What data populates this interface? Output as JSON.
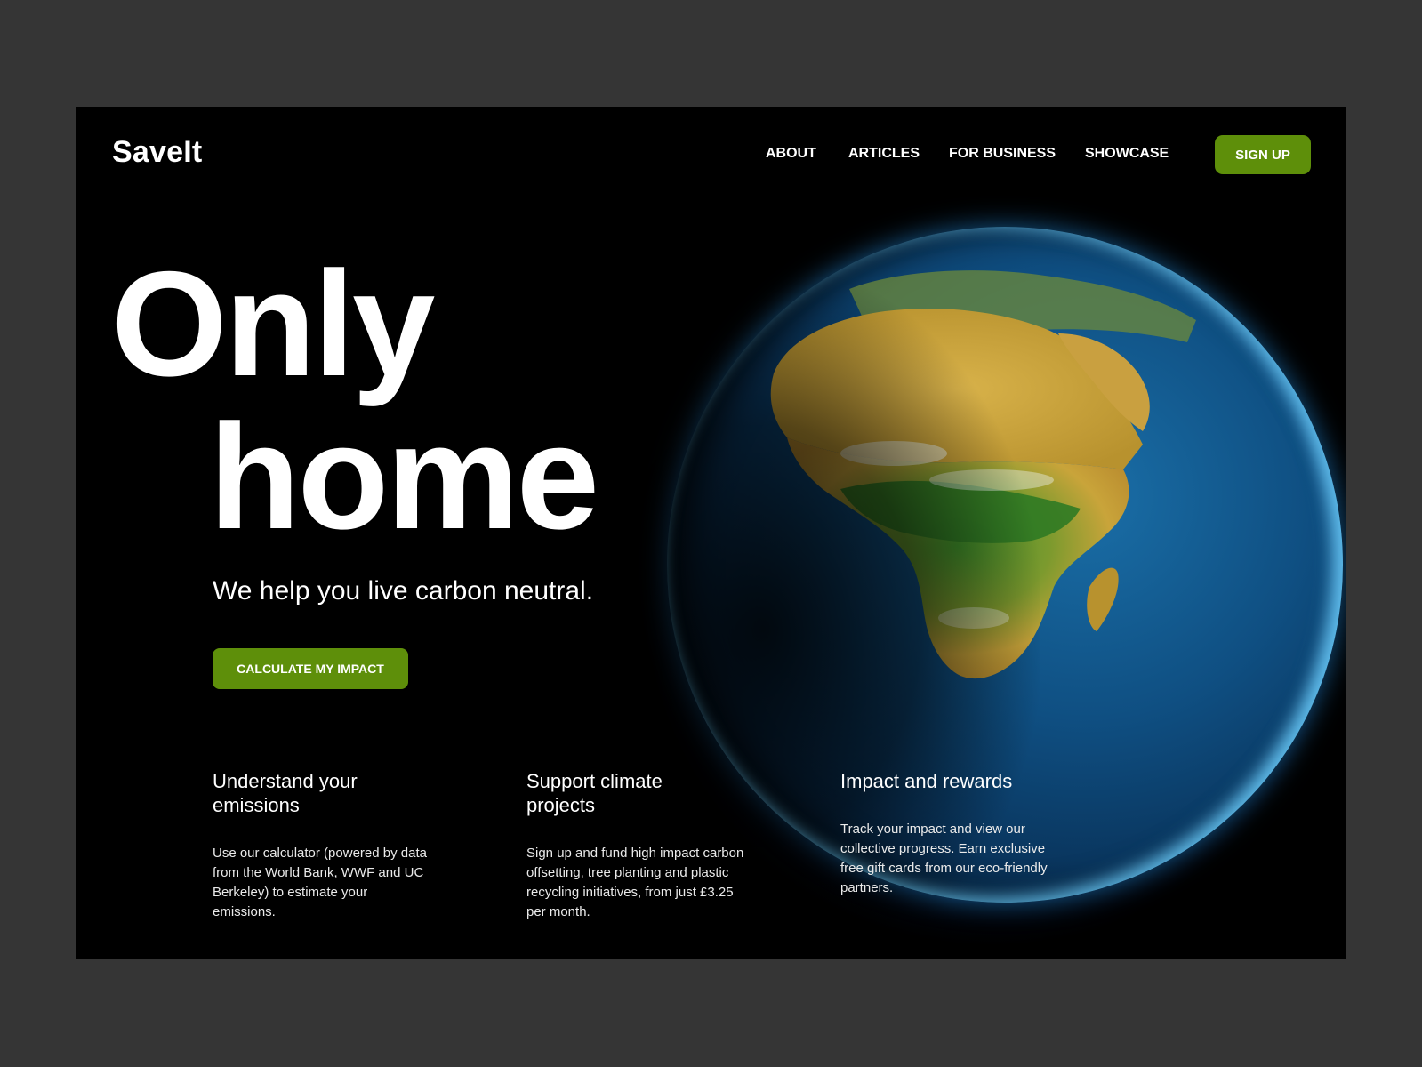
{
  "brand": {
    "name": "SaveIt"
  },
  "nav": {
    "items": [
      {
        "label": "ABOUT"
      },
      {
        "label": "ARTICLES"
      },
      {
        "label": "FOR BUSINESS"
      },
      {
        "label": "SHOWCASE"
      }
    ],
    "signup_label": "SIGN UP"
  },
  "hero": {
    "title_line1": "Only",
    "title_line2": "home",
    "tagline": "We help you live carbon neutral.",
    "cta_label": "CALCULATE MY IMPACT"
  },
  "features": [
    {
      "title": "Understand your emissions",
      "body": "Use our calculator (powered by data from the World Bank, WWF and UC Berkeley) to estimate your emissions."
    },
    {
      "title": "Support climate projects",
      "body": "Sign up and fund high impact carbon offsetting, tree planting and plastic recycling initiatives, from just £3.25 per month."
    },
    {
      "title": "Impact and rewards",
      "body": "Track your impact and view our collective progress. Earn exclusive free gift cards from our eco-friendly partners."
    }
  ],
  "colors": {
    "accent": "#5e8f0a",
    "background": "#000000",
    "outer": "#353535"
  },
  "visual": {
    "globe_icon": "earth-globe-image"
  }
}
